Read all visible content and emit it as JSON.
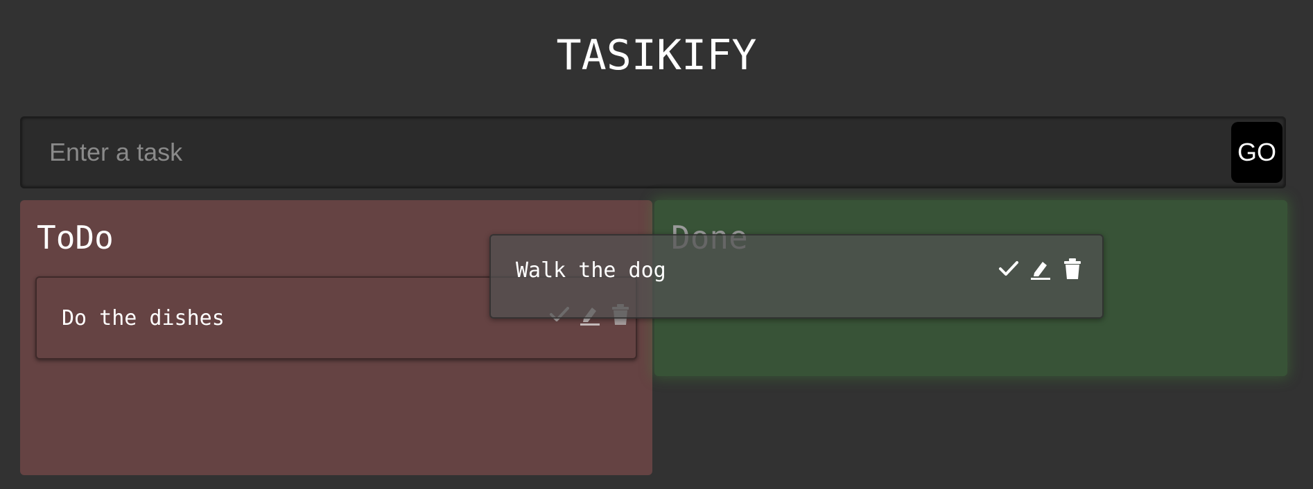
{
  "app": {
    "title": "TASIKIFY"
  },
  "input": {
    "placeholder": "Enter a task",
    "value": "",
    "submit_label": "GO"
  },
  "columns": {
    "todo": {
      "title": "ToDo",
      "tasks": [
        {
          "text": "Do the dishes"
        }
      ]
    },
    "done": {
      "title": "Done",
      "tasks": []
    }
  },
  "dragging": {
    "text": "Walk the dog"
  },
  "icons": {
    "complete": "check-icon",
    "edit": "pencil-icon",
    "delete": "trash-icon"
  },
  "colors": {
    "background": "#323232",
    "todo_column": "#654343",
    "done_column": "#385337",
    "go_button": "#000000"
  }
}
